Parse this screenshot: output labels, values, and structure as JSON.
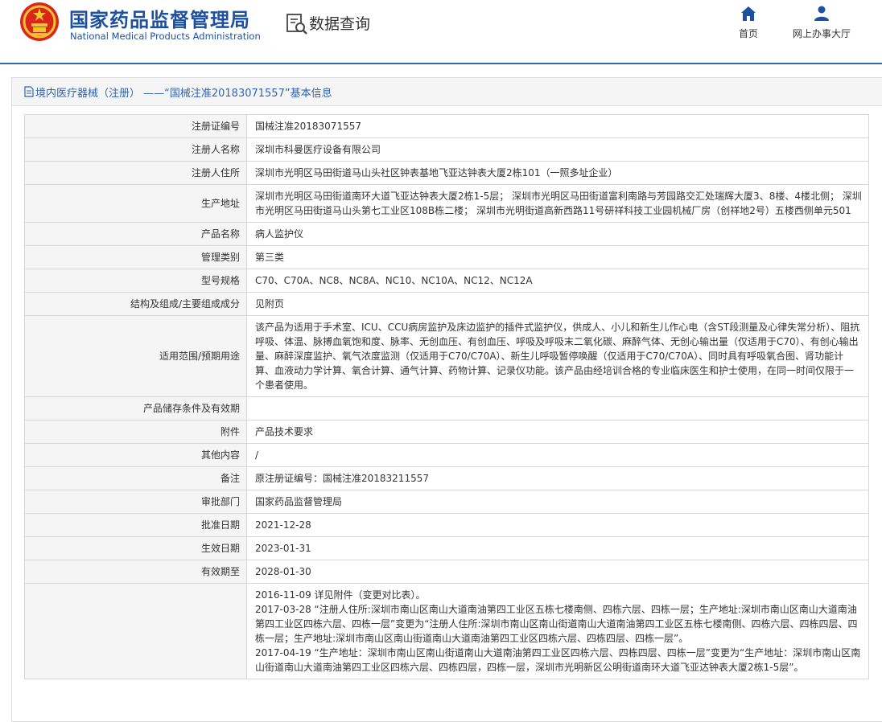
{
  "header": {
    "org_name_cn": "国家药品监督管理局",
    "org_name_en": "National Medical Products Administration",
    "section_title": "数据查询",
    "nav": [
      {
        "label": "首页",
        "icon": "home-icon"
      },
      {
        "label": "网上办事大厅",
        "icon": "user-icon"
      }
    ],
    "accent_color": "#1e50a2"
  },
  "breadcrumb": "境内医疗器械（注册） ——“国械注准20183071557”基本信息",
  "fields": [
    {
      "label": "注册证编号",
      "value": "国械注准20183071557"
    },
    {
      "label": "注册人名称",
      "value": "深圳市科曼医疗设备有限公司"
    },
    {
      "label": "注册人住所",
      "value": "深圳市光明区马田街道马山头社区钟表基地飞亚达钟表大厦2栋101（一照多址企业）"
    },
    {
      "label": "生产地址",
      "value": "深圳市光明区马田街道南环大道飞亚达钟表大厦2栋1-5层； 深圳市光明区马田街道富利南路与芳园路交汇处瑞辉大厦3、8楼、4楼北侧； 深圳市光明区马田街道马山头第七工业区108B栋二楼； 深圳市光明街道高新西路11号研祥科技工业园机械厂房（创祥地2号）五楼西侧单元501"
    },
    {
      "label": "产品名称",
      "value": "病人监护仪"
    },
    {
      "label": "管理类别",
      "value": "第三类"
    },
    {
      "label": "型号规格",
      "value": "C70、C70A、NC8、NC8A、NC10、NC10A、NC12、NC12A"
    },
    {
      "label": "结构及组成/主要组成成分",
      "value": "见附页"
    },
    {
      "label": "适用范围/预期用途",
      "value": "该产品为适用于手术室、ICU、CCU病房监护及床边监护的插件式监护仪，供成人、小儿和新生儿作心电（含ST段测量及心律失常分析）、阻抗呼吸、体温、脉搏血氧饱和度、脉率、无创血压、有创血压、呼吸及呼吸末二氧化碳、麻醉气体、无创心输出量（仅适用于C70）、有创心输出量、麻醉深度监护、氧气浓度监测（仅适用于C70/C70A）、新生儿呼吸暂停唤醒（仅适用于C70/C70A）、同时具有呼吸氧合图、肾功能计算、血液动力学计算、氧合计算、通气计算、药物计算、记录仪功能。该产品由经培训合格的专业临床医生和护士使用，在同一时间仅限于一个患者使用。"
    },
    {
      "label": "产品储存条件及有效期",
      "value": ""
    },
    {
      "label": "附件",
      "value": "产品技术要求"
    },
    {
      "label": "其他内容",
      "value": "/"
    },
    {
      "label": "备注",
      "value": "原注册证编号：国械注准20183211557"
    },
    {
      "label": "审批部门",
      "value": "国家药品监督管理局"
    },
    {
      "label": "批准日期",
      "value": "2021-12-28"
    },
    {
      "label": "生效日期",
      "value": "2023-01-31"
    },
    {
      "label": "有效期至",
      "value": "2028-01-30"
    }
  ],
  "change_history": [
    "2016-11-09 详见附件（变更对比表）。",
    "2017-03-28  “注册人住所:深圳市南山区南山大道南油第四工业区五栋七楼南侧、四栋六层、四栋一层；生产地址:深圳市南山区南山大道南油第四工业区四栋六层、四栋一层”变更为“注册人住所:深圳市南山区南山街道南山大道南油第四工业区五栋七楼南侧、四栋六层、四栋四层、四栋一层；生产地址:深圳市南山区南山街道南山大道南油第四工业区四栋六层、四栋四层、四栋一层”。",
    "2017-04-19  “生产地址：深圳市南山区南山街道南山大道南油第四工业区四栋六层、四栋四层、四栋一层”变更为“生产地址：深圳市南山区南山街道南山大道南油第四工业区四栋六层、四栋四层，四栋一层，深圳市光明新区公明街道南环大道飞亚达钟表大厦2栋1-5层”。"
  ]
}
